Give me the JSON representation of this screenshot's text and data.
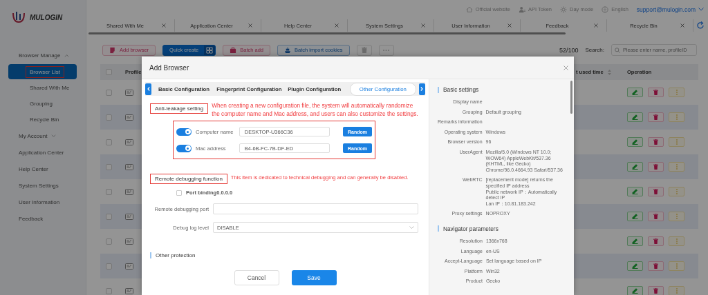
{
  "header": {
    "logo": "MULOGIN",
    "links": [
      {
        "label": "Official website"
      },
      {
        "label": "API Token"
      },
      {
        "label": "Day mode"
      },
      {
        "label": "English"
      }
    ],
    "account": "support@mulogin.com"
  },
  "open_tabs": [
    {
      "label": "Shared With Me"
    },
    {
      "label": "Application Center"
    },
    {
      "label": "Help Center"
    },
    {
      "label": "System Settings"
    },
    {
      "label": "User Information"
    },
    {
      "label": "Feedback"
    },
    {
      "label": "Recycle Bin"
    }
  ],
  "sidebar": {
    "items": [
      {
        "label": "Browser Manage",
        "kind": "group",
        "expanded": true,
        "children": [
          {
            "label": "Browser List",
            "selected": true,
            "annotated": true
          },
          {
            "label": "Shared With Me",
            "selected": false,
            "annotated": false
          },
          {
            "label": "Grouping",
            "selected": false,
            "annotated": false
          },
          {
            "label": "Recycle Bin",
            "selected": false,
            "annotated": false
          }
        ]
      },
      {
        "label": "My Account",
        "kind": "group",
        "expanded": false
      },
      {
        "label": "Application Center",
        "kind": "link"
      },
      {
        "label": "Help Center",
        "kind": "link"
      },
      {
        "label": "System Settings",
        "kind": "link"
      },
      {
        "label": "User Information",
        "kind": "link"
      },
      {
        "label": "Feedback",
        "kind": "link"
      }
    ]
  },
  "toolbar": {
    "buttons": [
      {
        "label": "Add browser",
        "kind": "danger"
      },
      {
        "label": "Quick create",
        "kind": "primary"
      },
      {
        "label": "Batch add",
        "kind": "danger"
      },
      {
        "label": "Batch import cookies",
        "kind": "outline"
      }
    ],
    "count": "52/100",
    "search_label": "Search:",
    "search_placeholder": "Please enter name, profileID"
  },
  "table": {
    "select_all_checked": false,
    "columns": [
      "Profile",
      "t used time",
      "Operation"
    ],
    "rows": [
      {
        "checked": false
      },
      {
        "checked": false
      },
      {
        "checked": false
      },
      {
        "checked": false
      },
      {
        "checked": false
      },
      {
        "checked": false
      },
      {
        "checked": false
      },
      {
        "checked": false
      },
      {
        "checked": false
      }
    ]
  },
  "dialog": {
    "title": "Add Browser",
    "tabs": [
      {
        "label": "Basic Configuration",
        "selected": false
      },
      {
        "label": "Fingerprint Configuration",
        "selected": false
      },
      {
        "label": "Plugin Configuration",
        "selected": false
      },
      {
        "label": "Other Configuration",
        "selected": true
      }
    ],
    "sections": [
      {
        "kind": "toggles",
        "title": "Anti-leakage setting",
        "annotated": true,
        "note": "When creating a new configuration file, the system will automatically randomize the computer name and Mac address, and users can also customize the settings.",
        "items": [
          {
            "label": "Computer name",
            "on": true,
            "value": "DESKTOP-U366C36",
            "button": "Random"
          },
          {
            "label": "Mac address",
            "on": true,
            "value": "B4-6B-FC-7B-DF-ED",
            "button": "Random"
          }
        ]
      },
      {
        "kind": "debug",
        "title": "Remote debugging function",
        "annotated": true,
        "note": "This item is dedicated to technical debugging and can generally be disabled.",
        "checkbox": {
          "label": "Port binding0.0.0.0",
          "checked": false
        },
        "fields": [
          {
            "label": "Remote debugging port",
            "kind": "input"
          },
          {
            "label": "Debug log level",
            "kind": "select",
            "value": "DISABLE"
          }
        ]
      },
      {
        "kind": "header",
        "title": "Other protection"
      }
    ],
    "buttons": [
      {
        "label": "Cancel",
        "kind": "default"
      },
      {
        "label": "Save",
        "kind": "primary"
      }
    ],
    "summary": [
      {
        "title": "Basic settings",
        "rows": [
          {
            "label": "Display name"
          },
          {
            "label": "Grouping",
            "lines": [
              "Default grouping"
            ]
          },
          {
            "label": "Remarks information"
          },
          {
            "label": "Operating system",
            "lines": [
              "Windows"
            ]
          },
          {
            "label": "Browser version",
            "lines": [
              "96"
            ]
          },
          {
            "label": "UserAgent",
            "lines": [
              "Mozilla/5.0 (Windows NT 10.0; WOW64) AppleWebKit/537.36 (KHTML, like Gecko) Chrome/96.0.4664.93 Safari/537.36"
            ]
          },
          {
            "label": "WebRTC",
            "lines": [
              "[replacement mode] returns the specified IP address",
              "Public network IP：Automatically detect IP",
              "Lan IP：10.81.183.242"
            ]
          },
          {
            "label": "Proxy settings",
            "lines": [
              "NOPROXY"
            ]
          }
        ]
      },
      {
        "title": "Navigator parameters",
        "rows": [
          {
            "label": "Resolution",
            "lines": [
              "1366x768"
            ]
          },
          {
            "label": "Language",
            "lines": [
              "en-US"
            ]
          },
          {
            "label": "Accept-Language",
            "lines": [
              "Set language based on IP"
            ]
          },
          {
            "label": "Platform",
            "lines": [
              "Win32"
            ]
          },
          {
            "label": "Product",
            "lines": [
              "Gecko"
            ]
          }
        ]
      }
    ]
  }
}
